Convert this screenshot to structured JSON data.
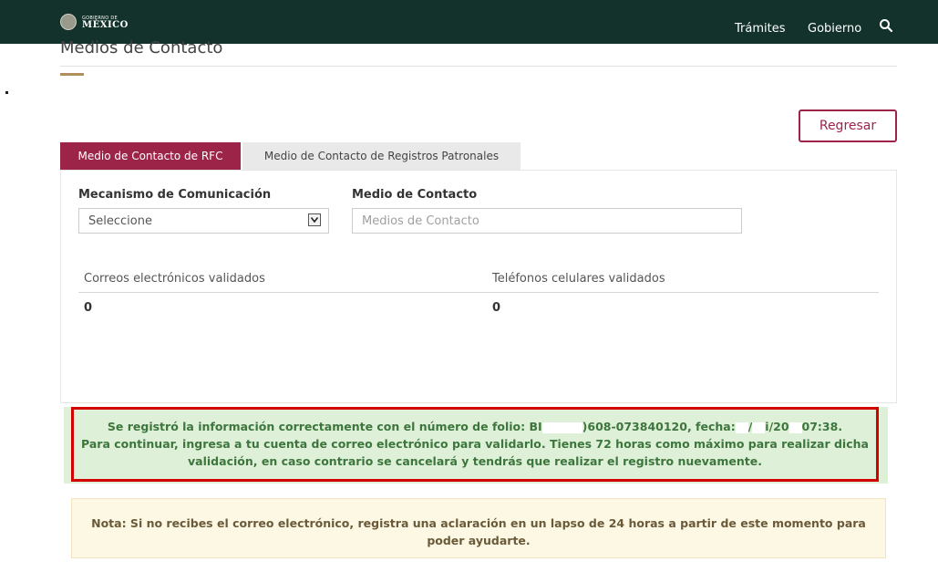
{
  "header": {
    "logo_small": "GOBIERNO DE",
    "logo_big": "MÉXICO",
    "nav": [
      "Trámites",
      "Gobierno"
    ]
  },
  "page": {
    "title": "Medios de Contacto",
    "back_button": "Regresar"
  },
  "tabs": [
    {
      "label": "Medio de Contacto de RFC",
      "active": true
    },
    {
      "label": "Medio de Contacto de Registros Patronales",
      "active": false
    }
  ],
  "form": {
    "mecanismo_label": "Mecanismo de Comunicación",
    "mecanismo_value": "Seleccione",
    "medio_label": "Medio de Contacto",
    "medio_placeholder": "Medios de Contacto"
  },
  "summary": {
    "headers": [
      "Correos electrónicos validados",
      "Teléfonos celulares validados"
    ],
    "values": [
      "0",
      "0"
    ]
  },
  "success_message": {
    "line1_a": "Se registró la información correctamente con el número de folio: BI",
    "line1_b": ")608-073840120, fecha:",
    "line1_c": "/",
    "line1_d": "i/20",
    "line1_e": "07:38.",
    "line2": "Para continuar, ingresa a tu cuenta de correo electrónico para validarlo. Tienes 72 horas como máximo para realizar dicha validación, en caso contrario se cancelará y tendrás que realizar el registro nuevamente."
  },
  "note": {
    "text": "Nota: Si no recibes el correo electrónico, registra una aclaración en un lapso de 24 horas a partir de este momento para poder ayudarte."
  },
  "colors": {
    "header_bg": "#13322b",
    "accent": "#9d2449",
    "gold": "#b38e5d",
    "success_bg": "#dff0d8",
    "success_text": "#3c763d",
    "highlight_border": "#d40000",
    "note_bg": "#fcf8e3"
  },
  "icons": {
    "search": "search-icon",
    "seal": "seal-icon",
    "dropdown": "chevron-down-icon"
  }
}
